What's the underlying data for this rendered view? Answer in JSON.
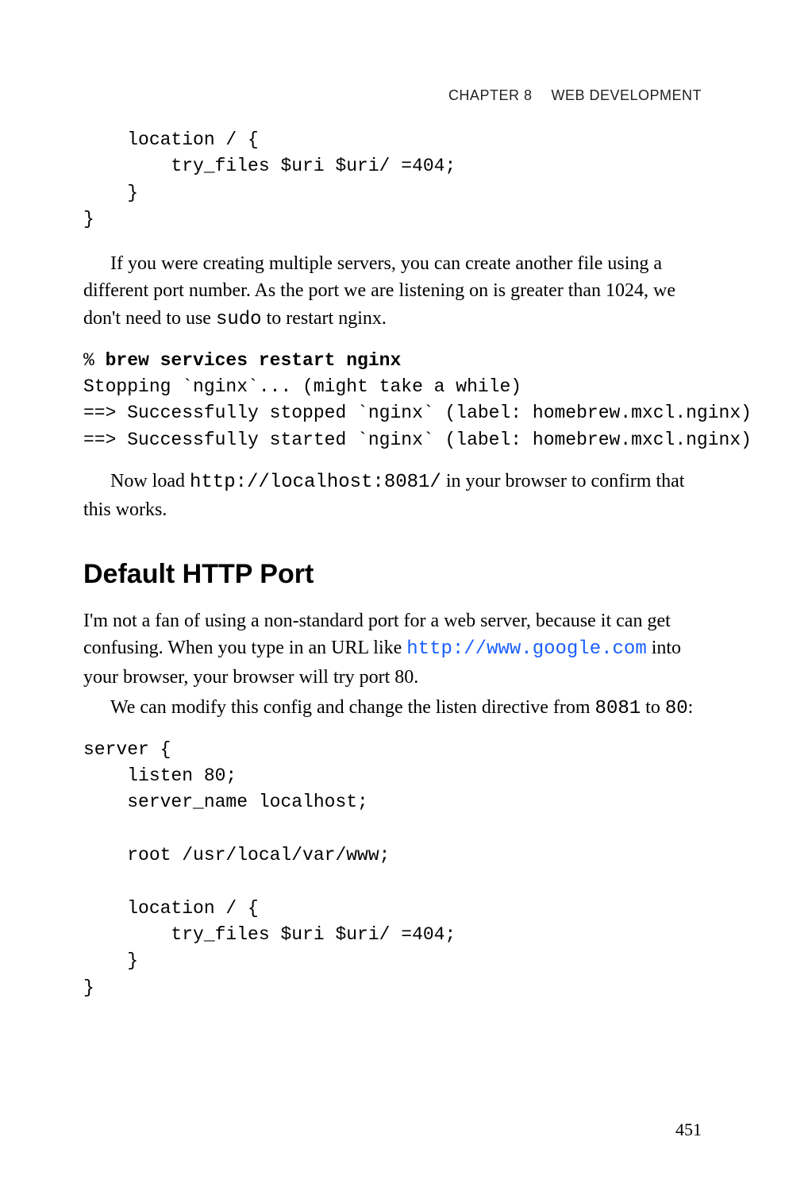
{
  "header": {
    "chapter": "Chapter 8",
    "title": "Web Development"
  },
  "codeblock1": "    location / {\n        try_files $uri $uri/ =404;\n    }\n}",
  "para1a": "If you were creating multiple servers, you can create another file using a different port number. As the port we are listening on is greater than 1024, we don't need to use ",
  "para1_mono": "sudo",
  "para1b": " to restart nginx.",
  "terminal": {
    "prompt": "% ",
    "cmd": "brew services restart nginx",
    "out": "Stopping `nginx`... (might take a while)\n==> Successfully stopped `nginx` (label: homebrew.mxcl.nginx)\n==> Successfully started `nginx` (label: homebrew.mxcl.nginx)"
  },
  "para2a": "Now load ",
  "para2_mono": "http://localhost:8081/",
  "para2b": " in your browser to confirm that this works.",
  "section_heading": "Default HTTP Port",
  "para3a": "I'm not a fan of using a non-standard port for a web server, because it can get confusing. When you type in an URL like ",
  "para3_link": "http://www.google.com",
  "para3b": " into your browser, your browser will try port 80.",
  "para4a": "We can modify this config and change the listen directive from ",
  "para4_mono1": "8081",
  "para4b": " to ",
  "para4_mono2": "80",
  "para4c": ":",
  "codeblock2": "server {\n    listen 80;\n    server_name localhost;\n\n    root /usr/local/var/www;\n\n    location / {\n        try_files $uri $uri/ =404;\n    }\n}",
  "page_number": "451"
}
